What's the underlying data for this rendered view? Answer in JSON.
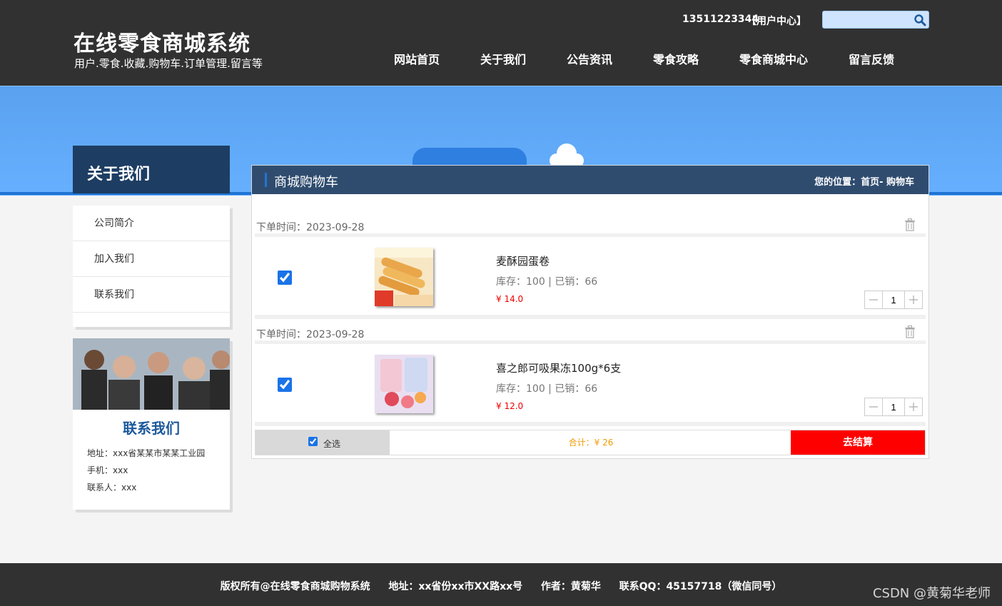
{
  "header": {
    "site_title": "在线零食商城系统",
    "site_subtitle": "用户.零食.收藏.购物车.订单管理.留言等",
    "user_phone": "13511223344",
    "user_center": "【用户中心】",
    "search_placeholder": ""
  },
  "nav": {
    "items": [
      "网站首页",
      "关于我们",
      "公告资讯",
      "零食攻略",
      "零食商城中心",
      "留言反馈"
    ]
  },
  "sidebar": {
    "title": "关于我们",
    "menu": [
      "公司简介",
      "加入我们",
      "联系我们"
    ],
    "contact": {
      "title": "联系我们",
      "address": "地址：xxx省某某市某某工业园",
      "phone": "手机：xxx",
      "contact_person": "联系人：xxx"
    }
  },
  "cart": {
    "title": "商城购物车",
    "location": "您的位置：首页- 购物车",
    "orders": [
      {
        "date_label": "下单时间：2023-09-28",
        "name": "麦酥园蛋卷",
        "stock_sales": "库存：100 | 已销：66",
        "price": "¥ 14.0",
        "quantity": "1",
        "checked": true,
        "thumb_icon": "egg-roll-product-image"
      },
      {
        "date_label": "下单时间：2023-09-28",
        "name": "喜之郎可吸果冻100g*6支",
        "stock_sales": "库存：100 | 已销：66",
        "price": "¥ 12.0",
        "quantity": "1",
        "checked": true,
        "thumb_icon": "jelly-product-image"
      }
    ],
    "footer": {
      "select_all": "全选",
      "total": "合计：¥ 26",
      "checkout": "去结算"
    }
  },
  "footer": {
    "copyright": "版权所有@在线零食商城购物系统",
    "address": "地址：xx省份xx市XX路xx号",
    "author": "作者：黄菊华",
    "qq": "联系QQ：45157718（微信同号）",
    "watermark": "CSDN @黄菊华老师"
  },
  "colors": {
    "header_bg": "#313131",
    "banner_blue": "#5aa2f0",
    "side_title_bg": "#1d3d63",
    "checkout_red": "#ff0000",
    "total_orange": "#f29b00",
    "price_red": "#ee0000"
  }
}
